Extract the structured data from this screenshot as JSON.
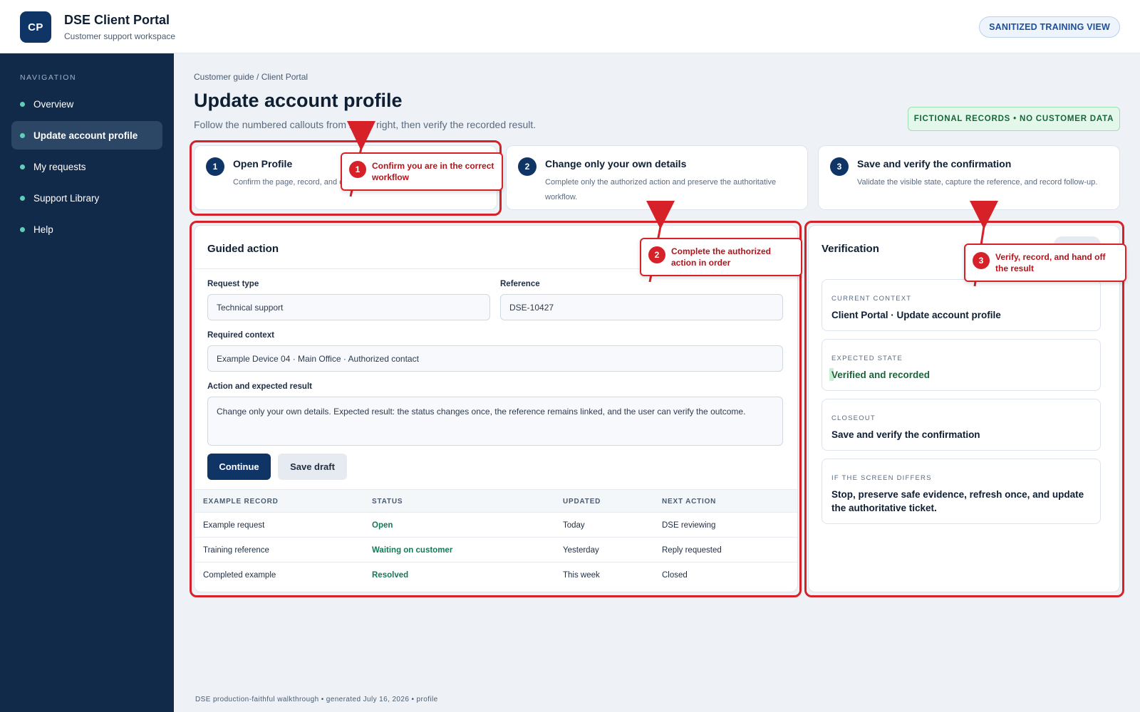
{
  "header": {
    "logo_text": "CP",
    "title": "DSE Client Portal",
    "subtitle": "Customer support workspace",
    "badge": "SANITIZED TRAINING VIEW"
  },
  "sidebar": {
    "heading": "NAVIGATION",
    "items": [
      {
        "label": "Overview",
        "active": false
      },
      {
        "label": "Update account profile",
        "active": true
      },
      {
        "label": "My requests",
        "active": false
      },
      {
        "label": "Support Library",
        "active": false
      },
      {
        "label": "Help",
        "active": false
      }
    ]
  },
  "main": {
    "breadcrumb": "Customer guide / Client Portal",
    "title": "Update account profile",
    "description": "Follow the numbered callouts from left to right, then verify the recorded result.",
    "records_badge": "FICTIONAL RECORDS • NO CUSTOMER DATA"
  },
  "steps": [
    {
      "number": "1",
      "title": "Open Profile",
      "description": "Confirm the page, record, and context."
    },
    {
      "number": "2",
      "title": "Change only your own details",
      "description": "Complete only the authorized action and preserve the authoritative workflow."
    },
    {
      "number": "3",
      "title": "Save and verify the confirmation",
      "description": "Validate the visible state, capture the reference, and record follow-up."
    }
  ],
  "guided_action": {
    "title": "Guided action",
    "request_type_label": "Request type",
    "request_type_value": "Technical support",
    "reference_label": "Reference",
    "reference_value": "DSE-10427",
    "context_label": "Required context",
    "context_value": "Example Device 04 · Main Office · Authorized contact",
    "action_label": "Action and expected result",
    "action_value": "Change only your own details. Expected result: the status changes once, the reference remains linked, and the user can verify the outcome.",
    "continue_label": "Continue",
    "save_draft_label": "Save draft"
  },
  "records": {
    "headers": [
      "EXAMPLE RECORD",
      "STATUS",
      "UPDATED",
      "NEXT ACTION"
    ],
    "rows": [
      [
        "Example request",
        "Open",
        "Today",
        "DSE reviewing"
      ],
      [
        "Training reference",
        "Waiting on customer",
        "Yesterday",
        "Reply requested"
      ],
      [
        "Completed example",
        "Resolved",
        "This week",
        "Closed"
      ]
    ]
  },
  "verification": {
    "title": "Verification",
    "items": [
      {
        "label": "CURRENT CONTEXT",
        "value": "Client Portal · Update account profile"
      },
      {
        "label": "EXPECTED STATE",
        "value": "Verified and recorded"
      },
      {
        "label": "CLOSEOUT",
        "value": "Save and verify the confirmation"
      },
      {
        "label": "IF THE SCREEN DIFFERS",
        "value": "Stop, preserve safe evidence, refresh once, and update the authoritative ticket."
      }
    ]
  },
  "callouts": [
    {
      "number": "1",
      "text": "Confirm you are in the correct workflow"
    },
    {
      "number": "2",
      "text": "Complete the authorized action in order"
    },
    {
      "number": "3",
      "text": "Verify, record, and hand off the result"
    }
  ],
  "footer": "DSE production-faithful walkthrough • generated July 16, 2026 • profile",
  "colors": {
    "brand_navy": "#0f3566",
    "sidebar_bg": "#122a4a",
    "callout_red": "#d62128",
    "status_green": "#14785a",
    "nav_dot": "#5fd0b8"
  }
}
